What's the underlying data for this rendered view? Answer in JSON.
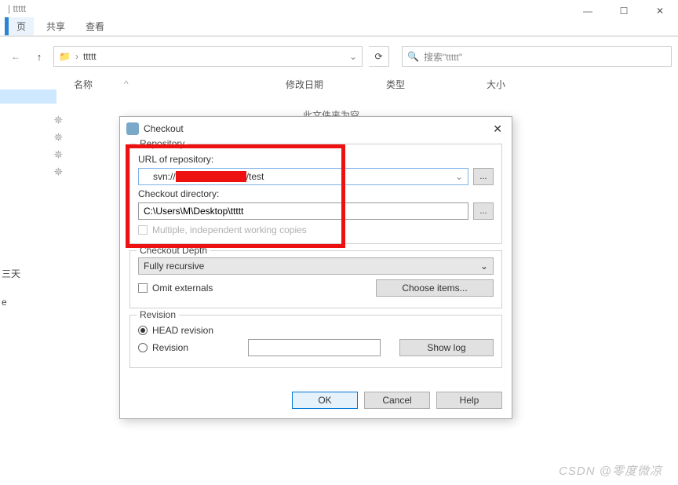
{
  "window": {
    "title": "| ttttt"
  },
  "caption": {
    "min": "—",
    "max": "☐",
    "close": "✕"
  },
  "tabs": {
    "left": "页",
    "share": "共享",
    "view": "查看"
  },
  "path": {
    "arrow": "›",
    "folder": "ttttt",
    "refresh": "⟳"
  },
  "search": {
    "placeholder": "搜索\"ttttt\""
  },
  "columns": {
    "name": "名称",
    "date": "修改日期",
    "type": "类型",
    "size": "大小",
    "caret": "^"
  },
  "sidebar": {
    "three_days": "三天",
    "e": "e"
  },
  "empty": "此文件夹为空。",
  "dialog": {
    "title": "Checkout",
    "close_glyph": "✕",
    "repo": {
      "group": "Repository",
      "url_label": "URL of repository:",
      "url_pre": "svn://",
      "url_mid_hidden": true,
      "url_post": "/test",
      "dir_label": "Checkout directory:",
      "dir_value": "C:\\Users\\M\\Desktop\\ttttt",
      "multi": "Multiple, independent working copies",
      "dots": "..."
    },
    "depth": {
      "group": "Checkout Depth",
      "value": "Fully recursive",
      "omit": "Omit externals",
      "choose": "Choose items..."
    },
    "rev": {
      "group": "Revision",
      "head": "HEAD revision",
      "rev": "Revision",
      "showlog": "Show log"
    },
    "buttons": {
      "ok": "OK",
      "cancel": "Cancel",
      "help": "Help"
    }
  },
  "watermark": "CSDN @零度微凉"
}
